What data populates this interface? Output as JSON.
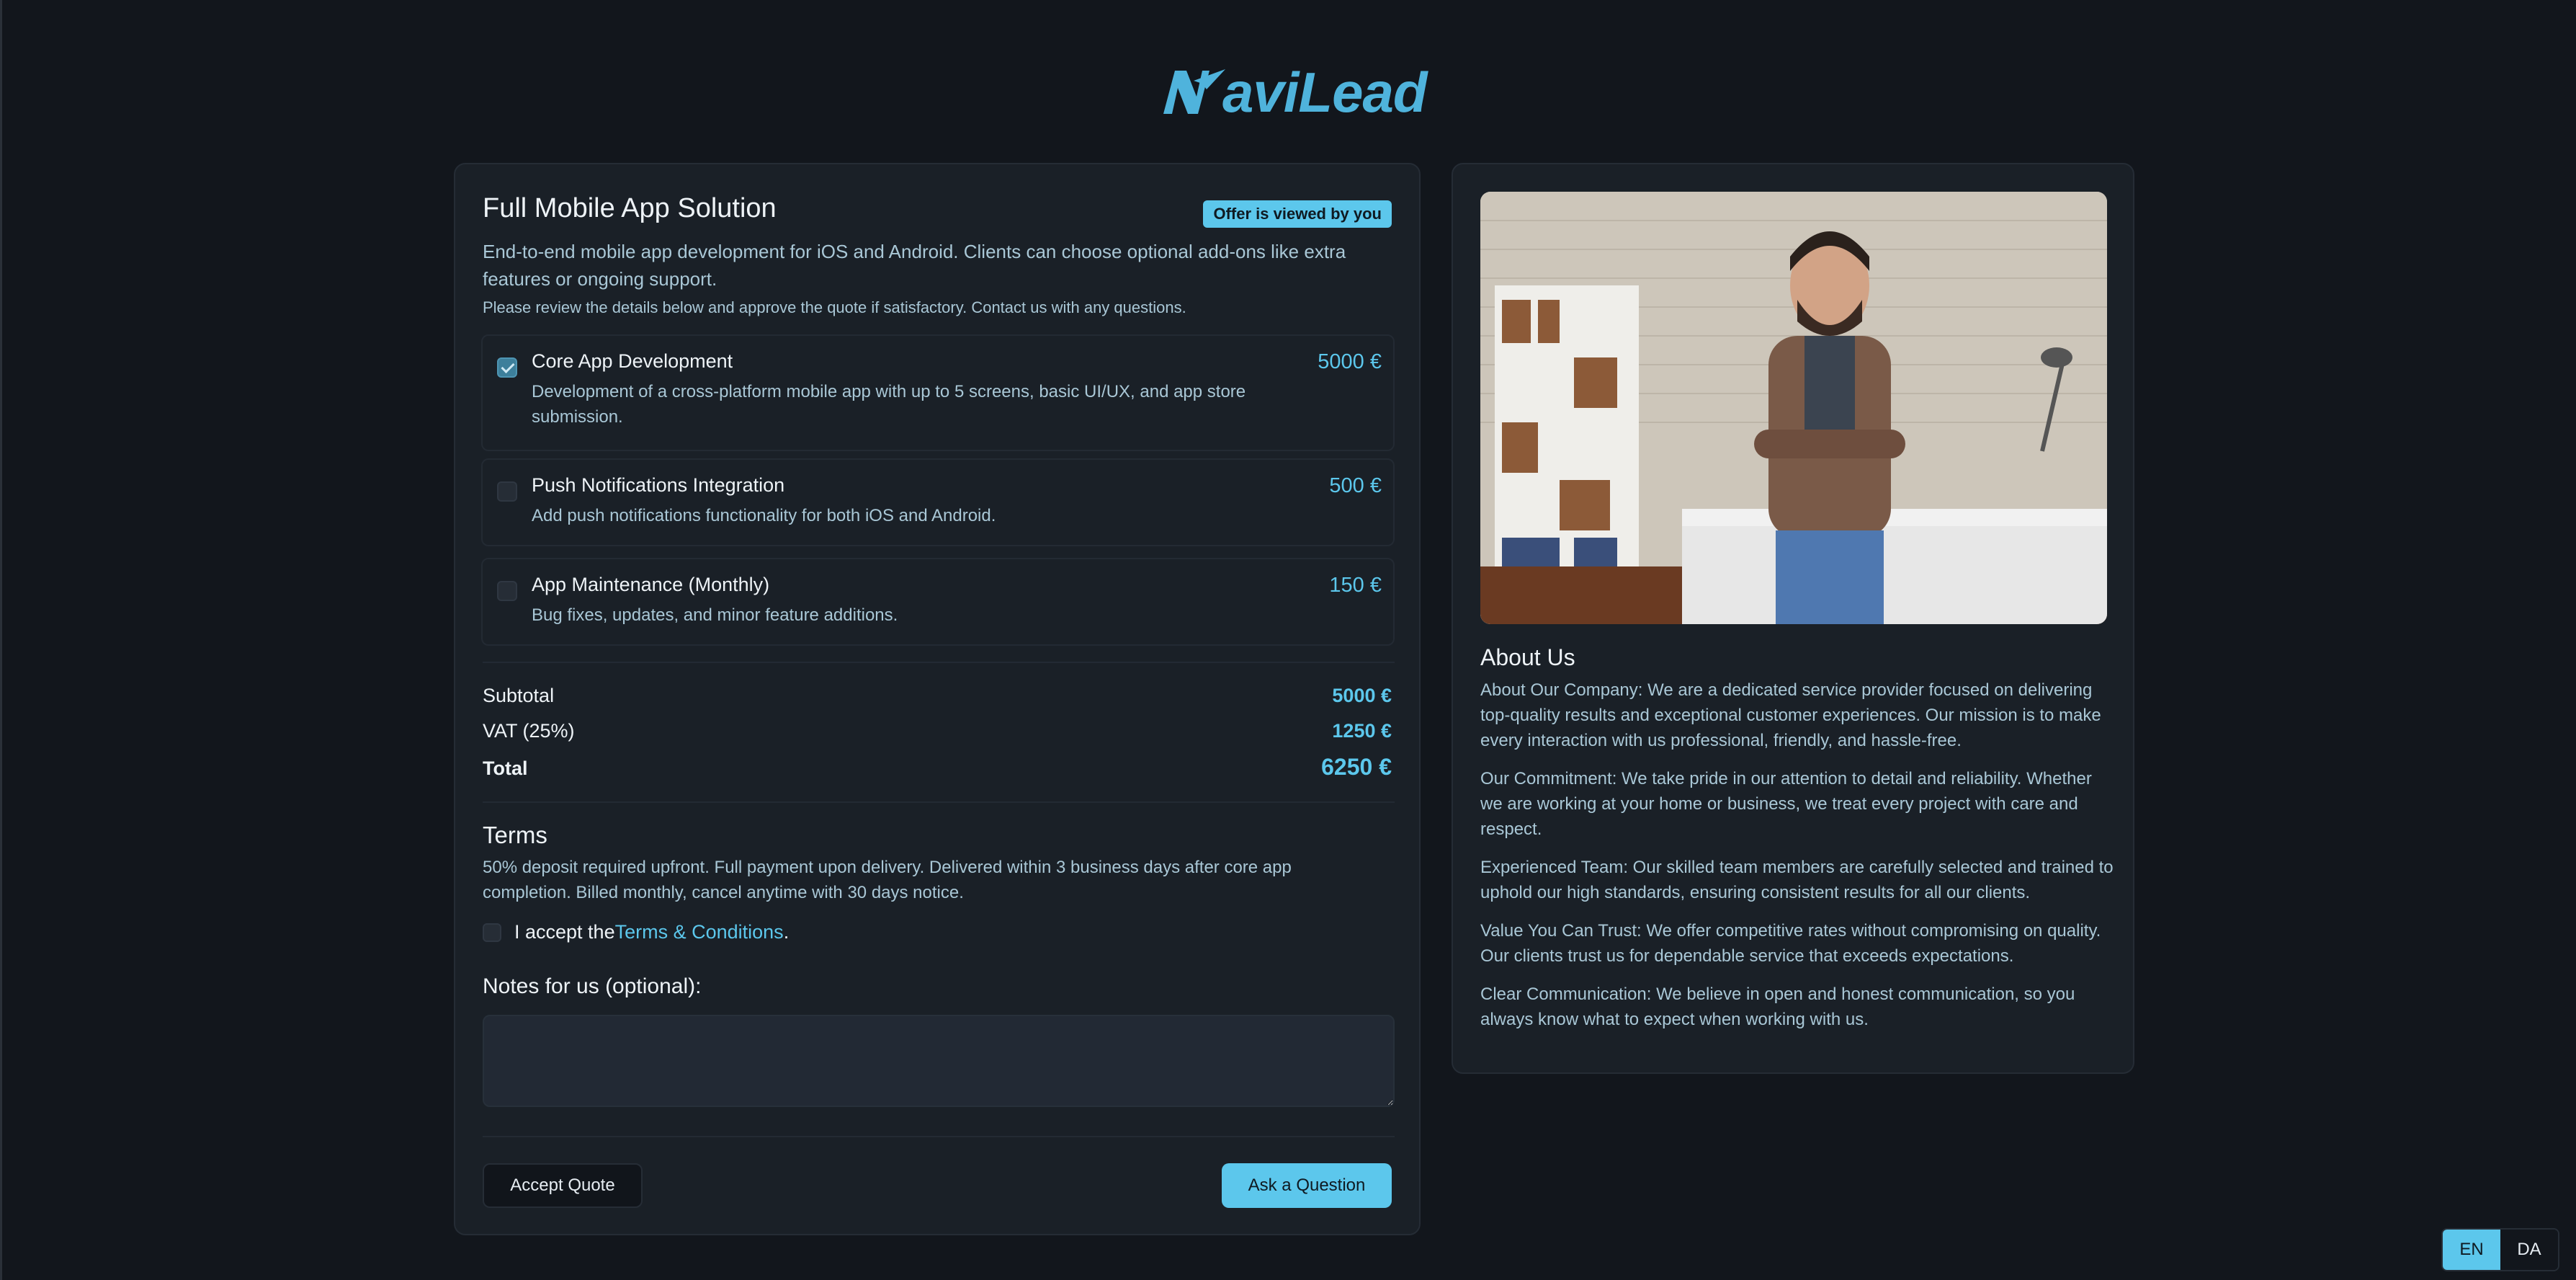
{
  "brand": {
    "logo_text": "aviLead",
    "accent_color": "#5cc7ec"
  },
  "quote": {
    "title": "Full Mobile App Solution",
    "viewed_badge": "Offer is viewed by you",
    "description": "End-to-end mobile app development for iOS and Android. Clients can choose optional add-ons like extra features or ongoing support.",
    "review_note": "Please review the details below and approve the quote if satisfactory. Contact us with any questions.",
    "items": [
      {
        "name": "Core App Development",
        "description": "Development of a cross-platform mobile app with up to 5 screens, basic UI/UX, and app store submission.",
        "price": "5000 €",
        "checked": true
      },
      {
        "name": "Push Notifications Integration",
        "description": "Add push notifications functionality for both iOS and Android.",
        "price": "500 €",
        "checked": false
      },
      {
        "name": "App Maintenance (Monthly)",
        "description": "Bug fixes, updates, and minor feature additions.",
        "price": "150 €",
        "checked": false
      }
    ],
    "summary": {
      "subtotal_label": "Subtotal",
      "subtotal_value": "5000 €",
      "vat_label": "VAT (25%)",
      "vat_value": "1250 €",
      "total_label": "Total",
      "total_value": "6250 €"
    },
    "terms": {
      "title": "Terms",
      "text": "50% deposit required upfront. Full payment upon delivery. Delivered within 3 business days after core app completion. Billed monthly, cancel anytime with 30 days notice.",
      "accept_prefix": "I accept the ",
      "accept_link": "Terms & Conditions",
      "accept_suffix": "."
    },
    "notes": {
      "label": "Notes for us (optional):",
      "value": "",
      "placeholder": ""
    },
    "buttons": {
      "accept": "Accept Quote",
      "ask": "Ask a Question"
    }
  },
  "about": {
    "photo_icon": "person-photo-icon",
    "title": "About Us",
    "paragraphs": [
      "About Our Company: We are a dedicated service provider focused on delivering top-quality results and exceptional customer experiences. Our mission is to make every interaction with us professional, friendly, and hassle-free.",
      "Our Commitment: We take pride in our attention to detail and reliability. Whether we are working at your home or business, we treat every project with care and respect.",
      "Experienced Team: Our skilled team members are carefully selected and trained to uphold our high standards, ensuring consistent results for all our clients.",
      "Value You Can Trust: We offer competitive rates without compromising on quality. Our clients trust us for dependable service that exceeds expectations.",
      "Clear Communication: We believe in open and honest communication, so you always know what to expect when working with us."
    ]
  },
  "language": {
    "options": [
      "EN",
      "DA"
    ],
    "selected": "EN"
  }
}
